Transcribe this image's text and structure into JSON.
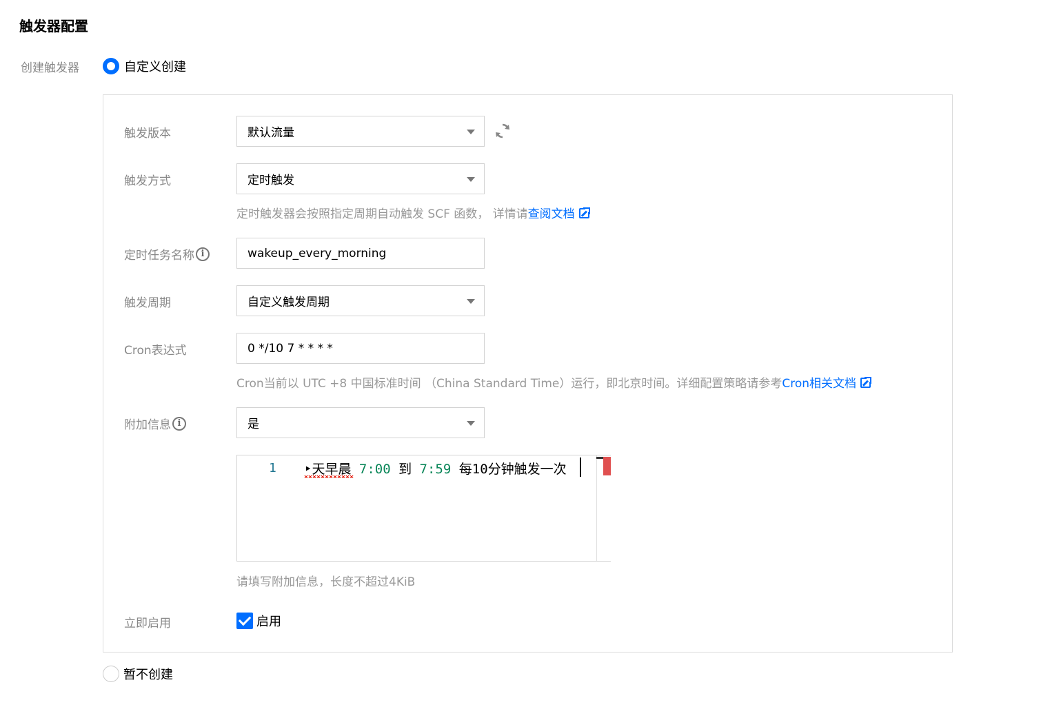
{
  "section_title": "触发器配置",
  "create_trigger_label": "创建触发器",
  "radio_custom": {
    "label": "自定义创建",
    "checked": true
  },
  "radio_skip": {
    "label": "暂不创建",
    "checked": false
  },
  "fields": {
    "version": {
      "label": "触发版本",
      "value": "默认流量"
    },
    "method": {
      "label": "触发方式",
      "value": "定时触发",
      "hint": "定时触发器会按照指定周期自动触发 SCF 函数， 详情请",
      "hint_link": "查阅文档"
    },
    "task_name": {
      "label": "定时任务名称",
      "value": "wakeup_every_morning"
    },
    "period": {
      "label": "触发周期",
      "value": "自定义触发周期"
    },
    "cron": {
      "label": "Cron表达式",
      "value": "0 */10 7 * * * *",
      "hint": "Cron当前以 UTC +8 中国标准时间 （China Standard Time）运行，即北京时间。详细配置策略请参考",
      "hint_link": "Cron相关文档"
    },
    "extra": {
      "label": "附加信息",
      "value": "是"
    },
    "editor": {
      "line_number": "1",
      "text_a": "‣天早晨 ",
      "num_a": "7:00",
      "text_b": " 到 ",
      "num_b": "7:59",
      "text_c": " 每10分钟触发一次",
      "hint": "请填写附加信息，长度不超过4KiB"
    },
    "enable": {
      "label": "立即启用",
      "checkbox_label": "启用",
      "checked": true
    }
  },
  "icons": [
    "refresh-icon",
    "info-icon",
    "external-link-icon",
    "dropdown-caret-icon",
    "checkmark-icon"
  ],
  "colors": {
    "accent": "#006eff",
    "label": "#888888",
    "hint": "#999999"
  }
}
